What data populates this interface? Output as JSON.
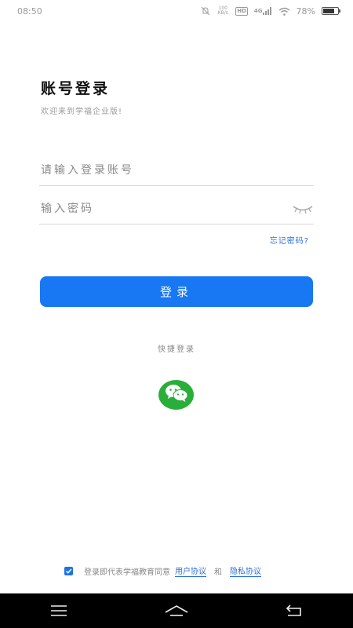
{
  "status_bar": {
    "time": "08:50",
    "net_speed": "100\nKB/s",
    "hd": "HD",
    "network": "4G",
    "battery_text": "78%",
    "battery_level": 0.78
  },
  "login": {
    "title": "账号登录",
    "subtitle": "欢迎来到学福企业版!",
    "account_placeholder": "请输入登录账号",
    "password_placeholder": "输入密码",
    "forgot_label": "忘记密码?",
    "login_button": "登录"
  },
  "quick_login": {
    "label": "快捷登录",
    "wechat_icon": "wechat-icon",
    "wechat_color": "#2aae3a"
  },
  "agreement": {
    "checked": true,
    "prefix": "登录即代表学福教育同意",
    "user_agreement": "用户协议",
    "and": "和",
    "privacy_policy": "隐私协议"
  },
  "colors": {
    "primary": "#1877f2",
    "link": "#2f6fd6"
  }
}
